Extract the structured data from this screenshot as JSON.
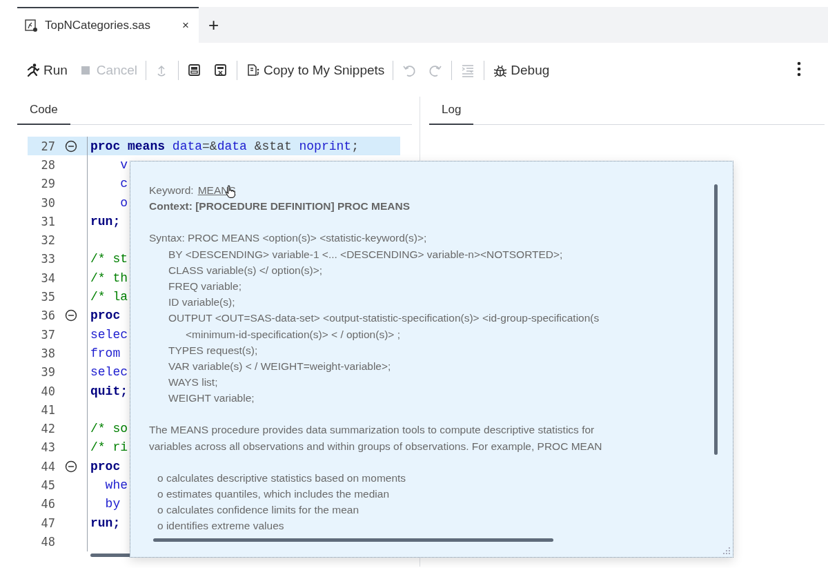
{
  "file_tabs": [
    {
      "label": "TopNCategories.sas",
      "selected": true,
      "close": "×"
    }
  ],
  "new_tab": "+",
  "toolbar": {
    "groups": [
      [
        {
          "label": "Run",
          "disabled": false
        },
        {
          "label": "Cancel",
          "disabled": true
        }
      ],
      [
        {
          "disabled": true
        }
      ],
      [
        {
          "disabled": false
        },
        {
          "disabled": false
        }
      ],
      [
        {
          "label": "Copy to My Snippets",
          "disabled": false
        }
      ],
      [
        {
          "disabled": true
        },
        {
          "disabled": true
        }
      ],
      [
        {
          "disabled": true
        }
      ],
      [
        {
          "label": "Debug",
          "disabled": false
        }
      ]
    ]
  },
  "code_panel": {
    "tab": {
      "label": "Code",
      "selected": true
    },
    "lines": [
      {
        "number": "27",
        "foldable": true,
        "current": true,
        "tokens": [
          {
            "text": "proc",
            "kind": "keyword"
          },
          {
            "text": " means",
            "kind": "keyword"
          },
          {
            "text": " data",
            "kind": "name"
          },
          {
            "text": "=&",
            "kind": "plain"
          },
          {
            "text": "data",
            "kind": "name"
          },
          {
            "text": " &stat ",
            "kind": "plain"
          },
          {
            "text": "noprint",
            "kind": "name"
          },
          {
            "text": ";",
            "kind": "plain"
          }
        ]
      },
      {
        "number": "28",
        "foldable": false,
        "current": false,
        "tokens": [
          {
            "text": "    v",
            "kind": "name"
          }
        ]
      },
      {
        "number": "29",
        "foldable": false,
        "current": false,
        "tokens": [
          {
            "text": "    c",
            "kind": "name"
          }
        ]
      },
      {
        "number": "30",
        "foldable": false,
        "current": false,
        "tokens": [
          {
            "text": "    o",
            "kind": "name"
          }
        ]
      },
      {
        "number": "31",
        "foldable": false,
        "current": false,
        "tokens": [
          {
            "text": "run;",
            "kind": "keyword"
          }
        ]
      },
      {
        "number": "32",
        "foldable": false,
        "current": false
      },
      {
        "number": "33",
        "foldable": false,
        "current": false,
        "tokens": [
          {
            "text": "/* st",
            "kind": "comment"
          }
        ]
      },
      {
        "number": "34",
        "foldable": false,
        "current": false,
        "tokens": [
          {
            "text": "/* th",
            "kind": "comment"
          }
        ]
      },
      {
        "number": "35",
        "foldable": false,
        "current": false,
        "tokens": [
          {
            "text": "/* la",
            "kind": "comment"
          }
        ]
      },
      {
        "number": "36",
        "foldable": true,
        "current": false,
        "tokens": [
          {
            "text": "proc",
            "kind": "keyword"
          }
        ]
      },
      {
        "number": "37",
        "foldable": false,
        "current": false,
        "tokens": [
          {
            "text": "selec",
            "kind": "name"
          }
        ]
      },
      {
        "number": "38",
        "foldable": false,
        "current": false,
        "tokens": [
          {
            "text": "from",
            "kind": "name"
          }
        ]
      },
      {
        "number": "39",
        "foldable": false,
        "current": false,
        "tokens": [
          {
            "text": "selec",
            "kind": "name"
          }
        ]
      },
      {
        "number": "40",
        "foldable": false,
        "current": false,
        "tokens": [
          {
            "text": "quit;",
            "kind": "keyword"
          }
        ]
      },
      {
        "number": "41",
        "foldable": false,
        "current": false
      },
      {
        "number": "42",
        "foldable": false,
        "current": false,
        "tokens": [
          {
            "text": "/* so",
            "kind": "comment"
          }
        ]
      },
      {
        "number": "43",
        "foldable": false,
        "current": false,
        "tokens": [
          {
            "text": "/* ri",
            "kind": "comment"
          }
        ]
      },
      {
        "number": "44",
        "foldable": true,
        "current": false,
        "tokens": [
          {
            "text": "proc",
            "kind": "keyword"
          }
        ]
      },
      {
        "number": "45",
        "foldable": false,
        "current": false,
        "tokens": [
          {
            "text": "  whe",
            "kind": "name"
          }
        ]
      },
      {
        "number": "46",
        "foldable": false,
        "current": false,
        "tokens": [
          {
            "text": "  by",
            "kind": "name"
          }
        ]
      },
      {
        "number": "47",
        "foldable": false,
        "current": false,
        "tokens": [
          {
            "text": "run;",
            "kind": "keyword"
          }
        ]
      },
      {
        "number": "48",
        "foldable": false,
        "current": false
      }
    ]
  },
  "log_panel": {
    "tab": {
      "label": "Log",
      "selected": true
    }
  },
  "tooltip": {
    "keyword_label": "Keyword:",
    "keyword": "MEANS",
    "context": "Context: [PROCEDURE DEFINITION] PROC MEANS",
    "syntax": [
      {
        "kind": "head",
        "text": "Syntax: PROC MEANS <option(s)> <statistic-keyword(s)>;"
      },
      {
        "kind": "statement",
        "text": "BY <DESCENDING> variable-1 <... <DESCENDING> variable-n><NOTSORTED>;"
      },
      {
        "kind": "statement",
        "text": "CLASS variable(s) </ option(s)>;"
      },
      {
        "kind": "statement",
        "text": "FREQ variable;"
      },
      {
        "kind": "statement",
        "text": "ID variable(s);"
      },
      {
        "kind": "statement",
        "text": "OUTPUT <OUT=SAS-data-set> <output-statistic-specification(s)> <id-group-specification(s"
      },
      {
        "kind": "continuation",
        "text": "<minimum-id-specification(s)> < / option(s)> ;"
      },
      {
        "kind": "statement",
        "text": "TYPES request(s);"
      },
      {
        "kind": "statement",
        "text": "VAR variable(s) < / WEIGHT=weight-variable>;"
      },
      {
        "kind": "statement",
        "text": "WAYS list;"
      },
      {
        "kind": "statement",
        "text": "WEIGHT variable;"
      }
    ],
    "description": [
      "The MEANS procedure provides data summarization tools to compute descriptive statistics for",
      "variables across all observations and within groups of observations. For example, PROC MEAN"
    ],
    "bullets": [
      "o calculates descriptive statistics based on moments",
      "o estimates quantiles, which includes the median",
      "o calculates confidence limits for the mean",
      "o identifies extreme values"
    ]
  }
}
